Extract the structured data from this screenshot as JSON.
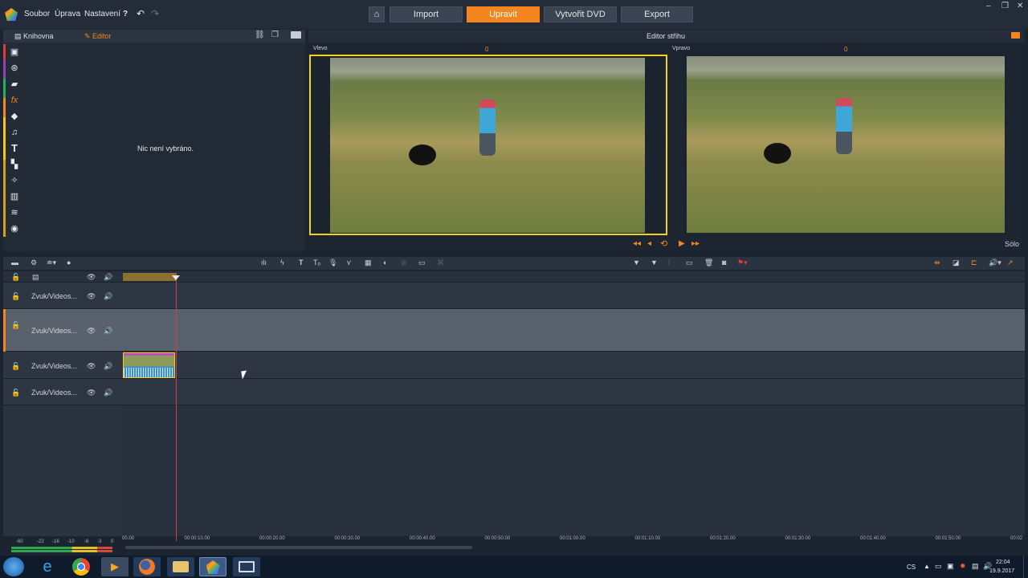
{
  "menu": {
    "file": "Soubor",
    "edit": "Úprava",
    "settings": "Nastavení",
    "help": "?"
  },
  "nav": {
    "import": "Import",
    "edit": "Upravit",
    "dvd": "Vytvořit DVD",
    "export": "Export"
  },
  "library": {
    "tab_library": "Knihovna",
    "tab_editor": "Editor",
    "empty_message": "Nic není vybráno."
  },
  "editor": {
    "title": "Editor střihu",
    "left_label": "Vlevo",
    "left_value": "0",
    "right_label": "Vpravo",
    "right_value": "0",
    "solo": "Sólo"
  },
  "tracks": [
    {
      "name": ""
    },
    {
      "name": "Zvuk/Videos..."
    },
    {
      "name": "Zvuk/Videos..."
    },
    {
      "name": "Zvuk/Videos..."
    },
    {
      "name": "Zvuk/Videos..."
    }
  ],
  "meter": {
    "labels": [
      "-60",
      "-22",
      "-16",
      "-10",
      "-6",
      "-3",
      "0"
    ]
  },
  "ruler": {
    "ticks": [
      "00.00",
      "00:00:10.00",
      "00:00:20.00",
      "00:00:30.00",
      "00:00:40.00",
      "00:00:50.00",
      "00:01:00.00",
      "00:01:10.00",
      "00:01:20.00",
      "00:01:30.00",
      "00:01:40.00",
      "00:01:50.00",
      "00:02"
    ]
  },
  "taskbar": {
    "lang": "CS",
    "time": "22:04",
    "date": "19.9.2017"
  },
  "colors": {
    "accent": "#f5861f",
    "selection": "#f2d21a",
    "playhead": "#d04040"
  }
}
